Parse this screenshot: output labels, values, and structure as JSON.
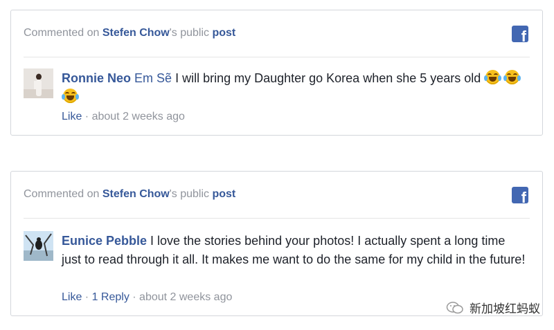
{
  "cards": [
    {
      "header": {
        "prefix": "Commented on ",
        "page_name": "Stefen Chow",
        "middle": "'s public ",
        "post_label": "post"
      },
      "facebook_icon": "facebook-icon",
      "comment": {
        "author": "Ronnie Neo",
        "mention": "Em Sẽ",
        "text": " I will bring my Daughter go Korea when she 5 years old",
        "emoji": "tears-of-joy-emoji"
      },
      "meta": {
        "like_label": "Like",
        "separator": " · ",
        "time": "about 2 weeks ago"
      }
    },
    {
      "header": {
        "prefix": "Commented on ",
        "page_name": "Stefen Chow",
        "middle": "'s public ",
        "post_label": "post"
      },
      "facebook_icon": "facebook-icon",
      "comment": {
        "author": "Eunice Pebble",
        "text": " I love the stories behind your photos! I actually spent a long time just to read through it all. It makes me want to do the same for my child in the future!"
      },
      "meta": {
        "like_label": "Like",
        "separator": " · ",
        "reply_label": "1 Reply",
        "time": "about 2 weeks ago"
      }
    }
  ],
  "watermark": {
    "text": "新加坡红蚂蚁",
    "icon": "wechat-icon"
  },
  "colors": {
    "link": "#365899",
    "muted": "#90949c",
    "facebook_blue": "#4267b2",
    "border": "#d3d6db"
  }
}
